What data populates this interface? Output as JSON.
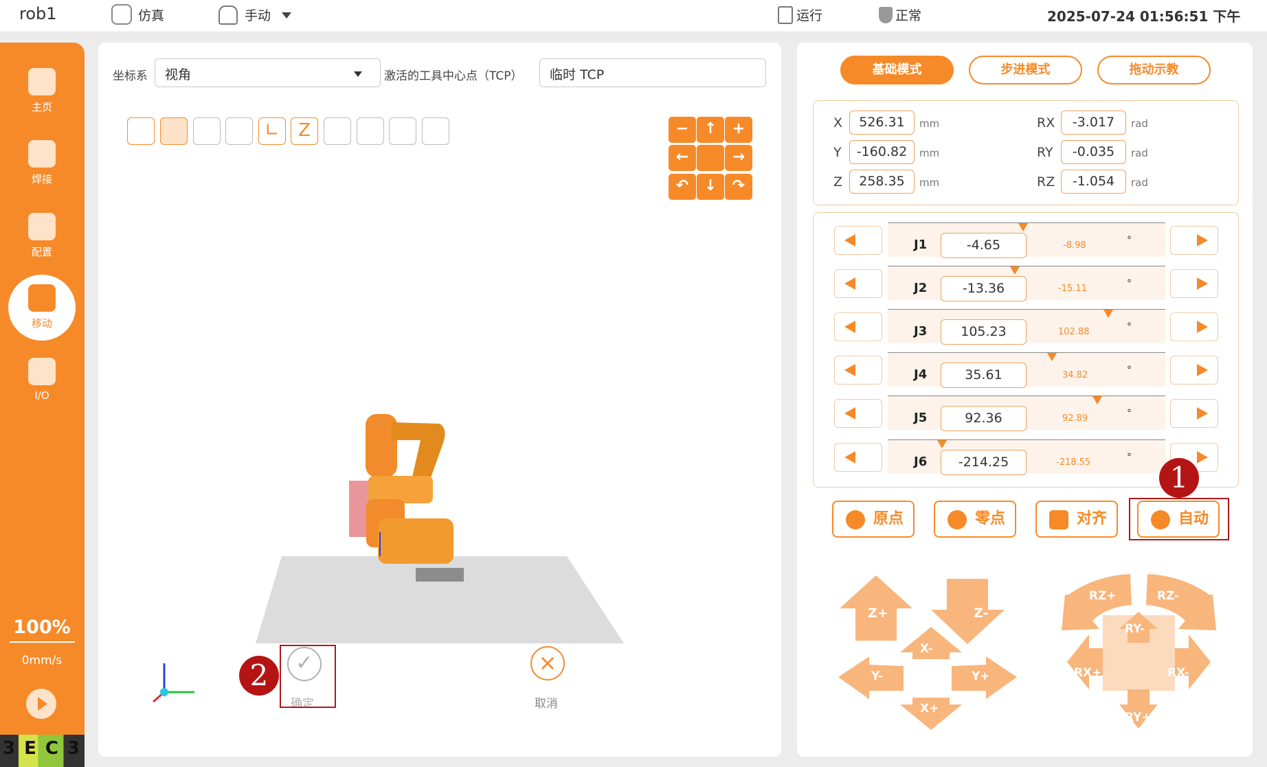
{
  "topbar": {
    "robot": "rob1",
    "mode_sim": "仿真",
    "mode_manual": "手动",
    "run": "运行",
    "status": "正常",
    "datetime": "2025-07-24 01:56:51 下午"
  },
  "sidebar": {
    "items": [
      {
        "label": "主页"
      },
      {
        "label": "焊接"
      },
      {
        "label": "配置"
      },
      {
        "label": "移动"
      },
      {
        "label": "I/O"
      }
    ],
    "speed_percent": "100%",
    "speed": "0mm/s",
    "logo": "3EC3"
  },
  "viewport": {
    "coord_label": "坐标系",
    "coord_value": "视角",
    "tcp_label": "激活的工具中心点（TCP）",
    "tcp_value": "临时 TCP",
    "confirm": "确定",
    "cancel": "取消"
  },
  "modes": {
    "basic": "基础模式",
    "step": "步进模式",
    "drag": "拖动示教"
  },
  "cartesian": {
    "x": {
      "label": "X",
      "value": "526.31",
      "unit": "mm"
    },
    "y": {
      "label": "Y",
      "value": "-160.82",
      "unit": "mm"
    },
    "z": {
      "label": "Z",
      "value": "258.35",
      "unit": "mm"
    },
    "rx": {
      "label": "RX",
      "value": "-3.017",
      "unit": "rad"
    },
    "ry": {
      "label": "RY",
      "value": "-0.035",
      "unit": "rad"
    },
    "rz": {
      "label": "RZ",
      "value": "-1.054",
      "unit": "rad"
    }
  },
  "joints": [
    {
      "name": "J1",
      "value": "-4.65",
      "target": "-8.98",
      "unit": "°"
    },
    {
      "name": "J2",
      "value": "-13.36",
      "target": "-15.11",
      "unit": "°"
    },
    {
      "name": "J3",
      "value": "105.23",
      "target": "102.88",
      "unit": "°"
    },
    {
      "name": "J4",
      "value": "35.61",
      "target": "34.82",
      "unit": "°"
    },
    {
      "name": "J5",
      "value": "92.36",
      "target": "92.89",
      "unit": "°"
    },
    {
      "name": "J6",
      "value": "-214.25",
      "target": "-218.55",
      "unit": "°"
    }
  ],
  "actions": {
    "origin": "原点",
    "zero": "零点",
    "align": "对齐",
    "auto": "自动"
  },
  "jog": {
    "zplus": "Z+",
    "zminus": "Z-",
    "xminus": "X-",
    "xplus": "X+",
    "yminus": "Y-",
    "yplus": "Y+",
    "rzplus": "RZ+",
    "rzminus": "RZ-",
    "ryminus": "RY-",
    "ryplus": "RY+",
    "rxplus": "RX+",
    "rxminus": "RX-"
  },
  "annotations": {
    "badge1": "1",
    "badge2": "2"
  },
  "colors": {
    "accent": "#f68a28",
    "annotation": "#b01818"
  }
}
